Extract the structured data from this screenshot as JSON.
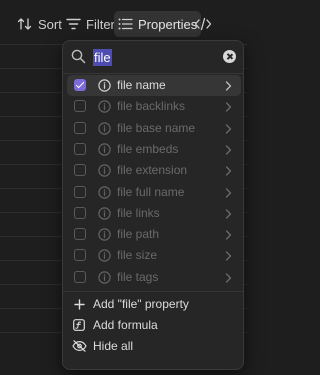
{
  "toolbar": {
    "sort_label": "Sort",
    "filter_label": "Filter",
    "properties_label": "Properties"
  },
  "search": {
    "value": "file"
  },
  "properties": [
    {
      "label": "file name",
      "checked": true
    },
    {
      "label": "file backlinks",
      "checked": false
    },
    {
      "label": "file base name",
      "checked": false
    },
    {
      "label": "file embeds",
      "checked": false
    },
    {
      "label": "file extension",
      "checked": false
    },
    {
      "label": "file full name",
      "checked": false
    },
    {
      "label": "file links",
      "checked": false
    },
    {
      "label": "file path",
      "checked": false
    },
    {
      "label": "file size",
      "checked": false
    },
    {
      "label": "file tags",
      "checked": false
    }
  ],
  "actions": {
    "add_property": "Add \"file\" property",
    "add_formula": "Add formula",
    "hide_all": "Hide all"
  },
  "colors": {
    "accent": "#7b6cd9",
    "selection": "#4d4cb1",
    "background": "#1e1e1e",
    "panel": "#262626"
  }
}
